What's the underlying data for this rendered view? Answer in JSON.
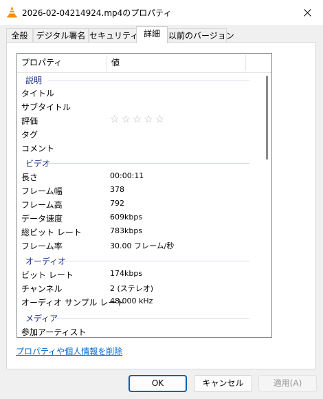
{
  "window": {
    "title": "2026-02-04214924.mp4のプロパティ"
  },
  "tabs": [
    {
      "label": "全般"
    },
    {
      "label": "デジタル署名"
    },
    {
      "label": "セキュリティ"
    },
    {
      "label": "詳細"
    },
    {
      "label": "以前のバージョン"
    }
  ],
  "details": {
    "header": {
      "name": "プロパティ",
      "value": "値"
    },
    "groups": {
      "description": "説明",
      "video": "ビデオ",
      "audio": "オーディオ",
      "media": "メディア"
    },
    "rows": {
      "title": {
        "k": "タイトル",
        "v": ""
      },
      "subtitle": {
        "k": "サブタイトル",
        "v": ""
      },
      "rating": {
        "k": "評価",
        "stars": 0,
        "max": 5
      },
      "tags": {
        "k": "タグ",
        "v": ""
      },
      "comments": {
        "k": "コメント",
        "v": ""
      },
      "length": {
        "k": "長さ",
        "v": "00:00:11"
      },
      "frame_width": {
        "k": "フレーム幅",
        "v": "378"
      },
      "frame_height": {
        "k": "フレーム高",
        "v": "792"
      },
      "data_rate": {
        "k": "データ速度",
        "v": "609kbps"
      },
      "total_bitrate": {
        "k": "総ビット レート",
        "v": "783kbps"
      },
      "frame_rate": {
        "k": "フレーム率",
        "v": "30.00 フレーム/秒"
      },
      "audio_bitrate": {
        "k": "ビット レート",
        "v": "174kbps"
      },
      "channels": {
        "k": "チャンネル",
        "v": "2 (ステレオ)"
      },
      "sample_rate": {
        "k": "オーディオ サンプル レート",
        "v": "48.000 kHz"
      },
      "contributing_artists": {
        "k": "参加アーティスト",
        "v": ""
      }
    }
  },
  "remove_link": "プロパティや個人情報を削除",
  "buttons": {
    "ok": "OK",
    "cancel": "キャンセル",
    "apply": "適用(A)"
  },
  "colors": {
    "accent": "#005fb8",
    "group_text": "#1e3287",
    "link": "#0066cc"
  }
}
